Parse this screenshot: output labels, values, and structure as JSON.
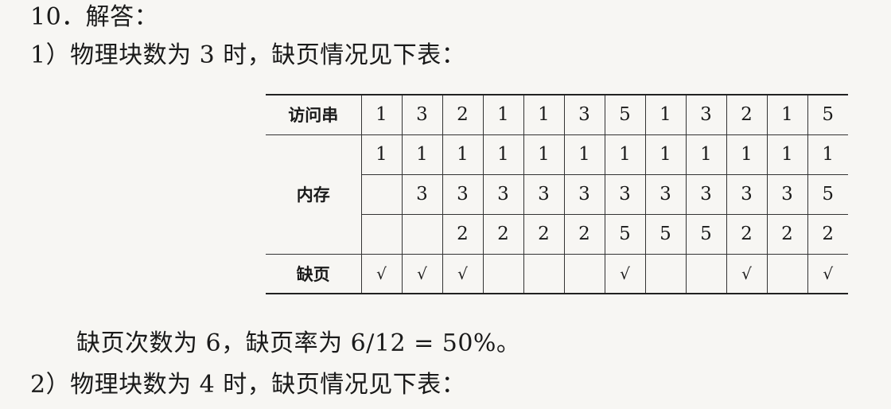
{
  "text": {
    "title": "10．解答：",
    "part1": "1）物理块数为 3 时，缺页情况见下表：",
    "summary": "缺页次数为 6，缺页率为 6/12 = 50%。",
    "part2": "2）物理块数为 4 时，缺页情况见下表："
  },
  "table": {
    "access_label": "访问串",
    "memory_label": "内存",
    "fault_label": "缺页",
    "access": [
      "1",
      "3",
      "2",
      "1",
      "1",
      "3",
      "5",
      "1",
      "3",
      "2",
      "1",
      "5"
    ],
    "memory": [
      [
        "1",
        "1",
        "1",
        "1",
        "1",
        "1",
        "1",
        "1",
        "1",
        "1",
        "1",
        "1"
      ],
      [
        "",
        "3",
        "3",
        "3",
        "3",
        "3",
        "3",
        "3",
        "3",
        "3",
        "3",
        "5"
      ],
      [
        "",
        "",
        "2",
        "2",
        "2",
        "2",
        "5",
        "5",
        "5",
        "2",
        "2",
        "2"
      ]
    ],
    "fault": [
      "√",
      "√",
      "√",
      "",
      "",
      "",
      "√",
      "",
      "",
      "√",
      "",
      "√"
    ]
  }
}
